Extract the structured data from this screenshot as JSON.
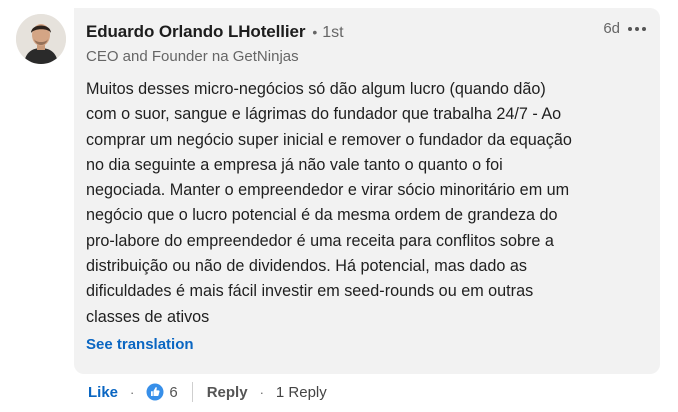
{
  "comment": {
    "author": {
      "name": "Eduardo Orlando LHotellier",
      "degree_separator": "•",
      "degree": "1st",
      "headline": "CEO and Founder na GetNinjas"
    },
    "time": "6d",
    "more_icon": "ellipsis-icon",
    "text": "Muitos desses micro-negócios só dão algum lucro (quando dão)\ncom o suor, sangue e lágrimas do fundador que trabalha 24/7 - Ao\ncomprar um negócio super inicial e remover o fundador da equação\nno dia seguinte a empresa já não vale tanto o quanto o foi\nnegociada. Manter o empreendedor e virar sócio minoritário em um\nnegócio que o lucro potencial é da mesma ordem de grandeza do\npro-labore do empreendedor é uma receita para conflitos sobre a\ndistribuição ou não de dividendos. Há potencial, mas dado as\ndificuldades é mais fácil investir em seed-rounds ou em outras\nclasses de ativos",
    "see_translation": "See translation"
  },
  "actions": {
    "like_label": "Like",
    "separator": "·",
    "reaction_icon": "thumbs-up-icon",
    "reaction_count": "6",
    "reply_label": "Reply",
    "reply_count": "1 Reply"
  },
  "colors": {
    "accent_link": "#0a66c2",
    "bubble_bg": "#f2f2f2",
    "secondary_text": "#666666"
  }
}
